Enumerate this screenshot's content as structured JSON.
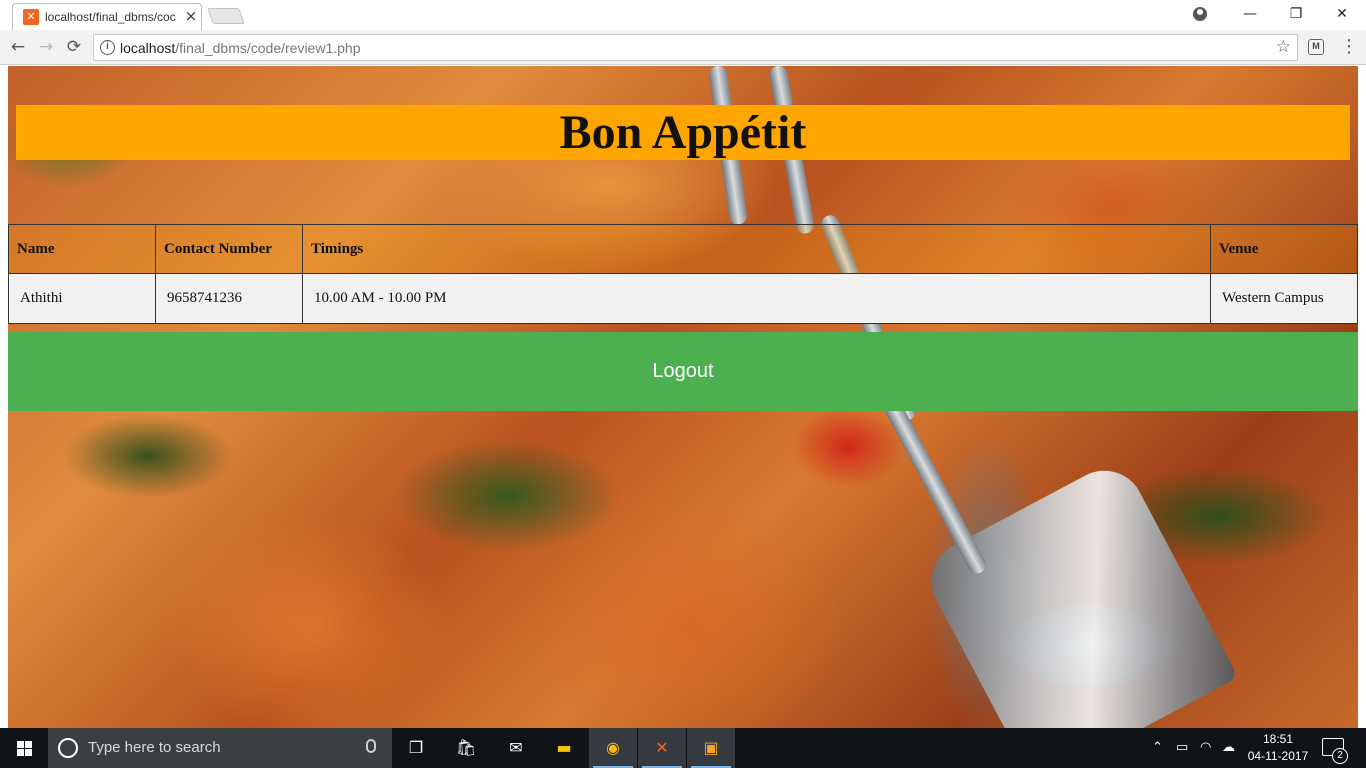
{
  "browser": {
    "tab_title": "localhost/final_dbms/coc",
    "tab_close": "×",
    "favicon_glyph": "✕",
    "url_host": "localhost",
    "url_path": "/final_dbms/code/review1.php",
    "info_glyph": "i",
    "ext_glyph": "M",
    "window_controls": {
      "minimize": "—",
      "maximize": "❐",
      "close": "✕"
    },
    "nav": {
      "back": "←",
      "forward": "→",
      "reload": "⟳",
      "star": "☆",
      "menu": "⋮"
    }
  },
  "page": {
    "banner_title": "Bon Appétit",
    "banner_color": "#ffa500",
    "table": {
      "headers": [
        "Name",
        "Contact Number",
        "Timings",
        "Venue"
      ],
      "rows": [
        [
          "Athithi",
          "9658741236",
          " 10.00 AM - 10.00 PM",
          "Western Campus"
        ]
      ]
    },
    "logout_label": "Logout",
    "logout_color": "#4caf50"
  },
  "taskbar": {
    "search_placeholder": "Type here to search",
    "clock_time": "18:51",
    "clock_date": "04-11-2017",
    "notification_count": "2",
    "icons": [
      "start-icon",
      "cortana-icon",
      "task-view-icon",
      "store-icon",
      "mail-icon",
      "file-explorer-icon",
      "chrome-icon",
      "xampp-icon",
      "app-icon"
    ]
  }
}
